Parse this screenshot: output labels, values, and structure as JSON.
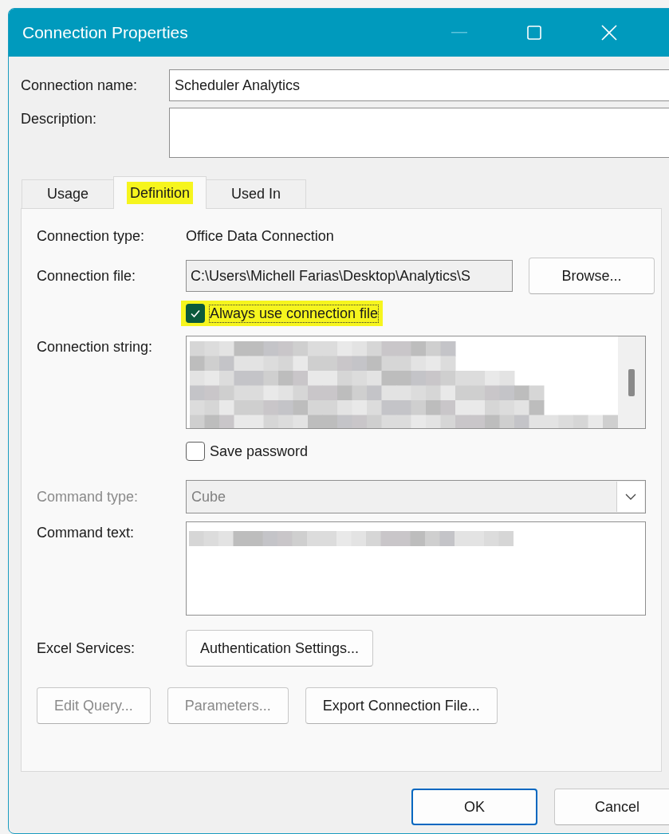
{
  "window": {
    "title": "Connection Properties"
  },
  "connection_name": {
    "label": "Connection name:",
    "value": "Scheduler Analytics"
  },
  "description": {
    "label": "Description:"
  },
  "tabs": [
    {
      "label": "Usage",
      "selected": false,
      "highlighted": false
    },
    {
      "label": "Definition",
      "selected": true,
      "highlighted": true
    },
    {
      "label": "Used In",
      "selected": false,
      "highlighted": false
    }
  ],
  "definition": {
    "connection_type": {
      "label": "Connection type:",
      "value": "Office Data Connection"
    },
    "connection_file": {
      "label": "Connection file:",
      "value": "C:\\Users\\Michell Farias\\Desktop\\Analytics\\S",
      "button": "Browse..."
    },
    "always_use_file": {
      "label": "Always use connection file",
      "checked": true,
      "highlighted": true
    },
    "connection_string": {
      "label": "Connection string:"
    },
    "save_password": {
      "label": "Save password",
      "checked": false
    },
    "command_type": {
      "label": "Command type:",
      "value": "Cube",
      "disabled": true
    },
    "command_text": {
      "label": "Command text:"
    },
    "excel_services": {
      "label": "Excel Services:",
      "button": "Authentication Settings..."
    },
    "actions": [
      {
        "label": "Edit Query...",
        "disabled": true
      },
      {
        "label": "Parameters...",
        "disabled": true
      },
      {
        "label": "Export Connection File...",
        "disabled": false
      }
    ]
  },
  "buttons": [
    {
      "label": "OK",
      "default": true
    },
    {
      "label": "Cancel",
      "default": false
    }
  ]
}
